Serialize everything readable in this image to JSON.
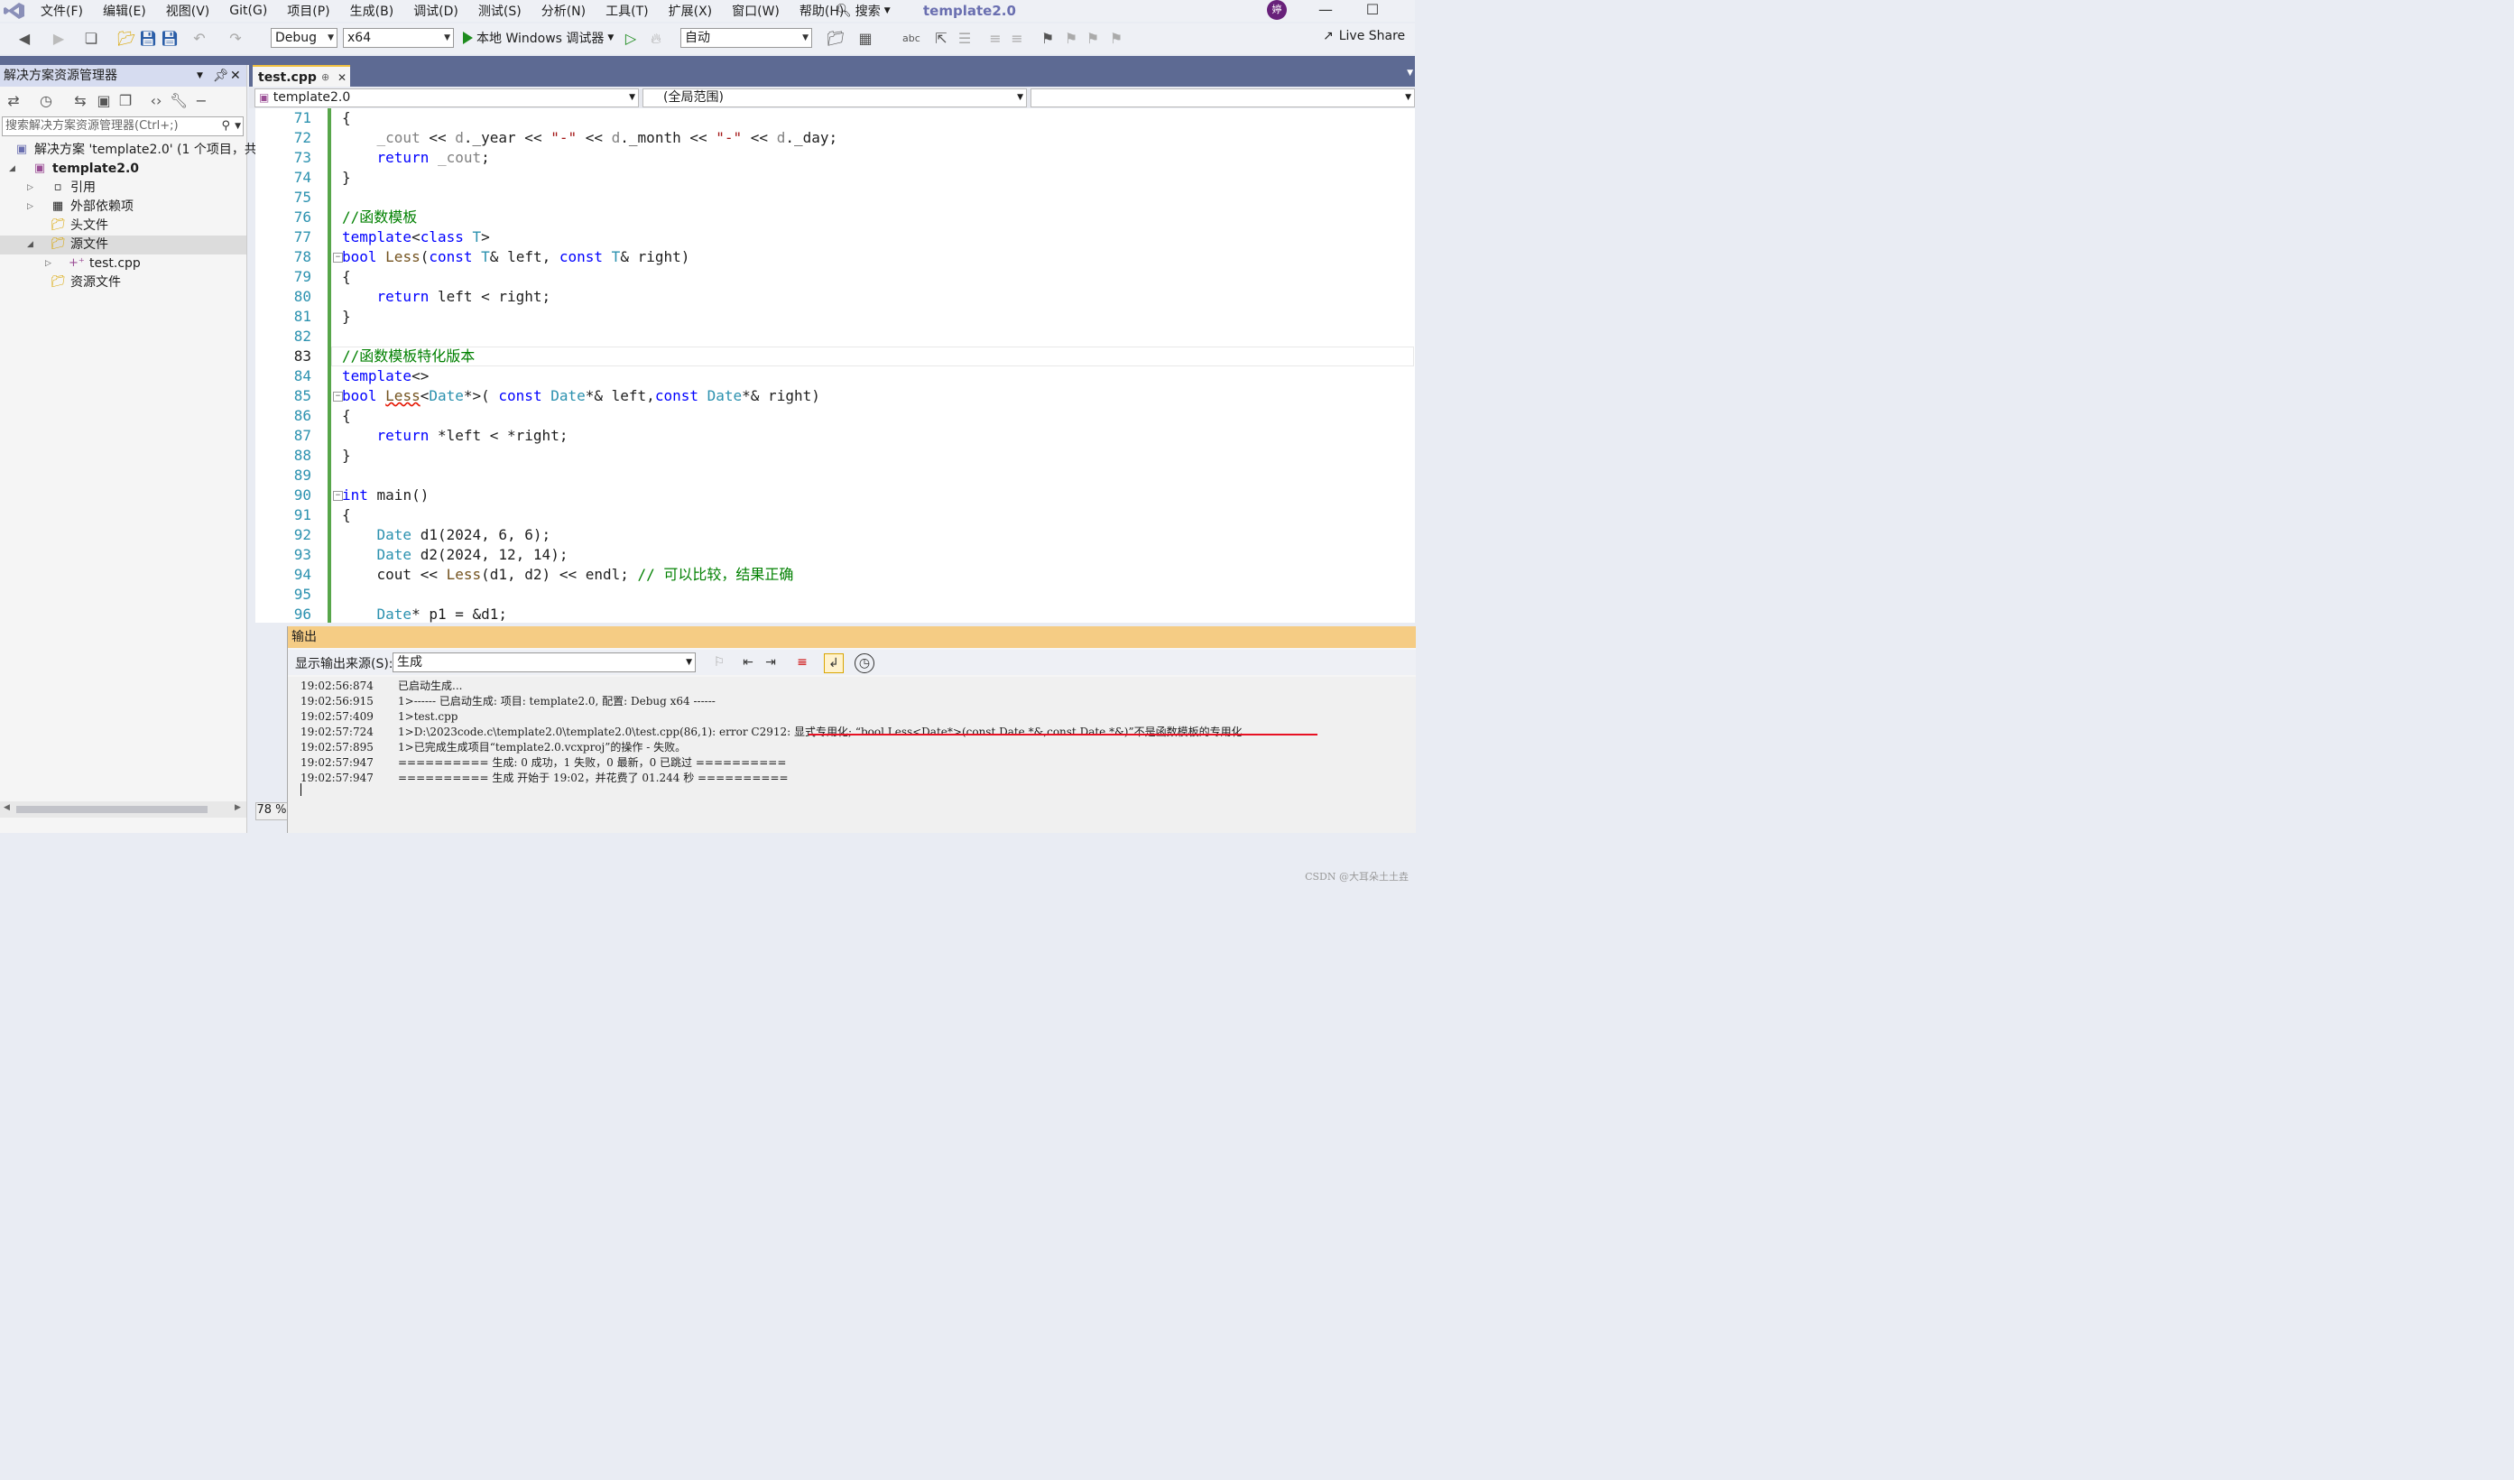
{
  "menubar": {
    "items": [
      "文件(F)",
      "编辑(E)",
      "视图(V)",
      "Git(G)",
      "项目(P)",
      "生成(B)",
      "调试(D)",
      "测试(S)",
      "分析(N)",
      "工具(T)",
      "扩展(X)",
      "窗口(W)",
      "帮助(H)"
    ],
    "search_label": "搜索",
    "window_title": "template2.0",
    "avatar_text": "婷"
  },
  "toolbar": {
    "config": "Debug",
    "platform": "x64",
    "run_label": "本地 Windows 调试器",
    "stack": "自动",
    "live_share": "Live Share"
  },
  "solution_explorer": {
    "title": "解决方案资源管理器",
    "search_placeholder": "搜索解决方案资源管理器(Ctrl+;)",
    "items": [
      {
        "label": "解决方案 'template2.0' (1 个项目，共"
      },
      {
        "label": "template2.0"
      },
      {
        "label": "引用"
      },
      {
        "label": "外部依赖项"
      },
      {
        "label": "头文件"
      },
      {
        "label": "源文件"
      },
      {
        "label": "test.cpp"
      },
      {
        "label": "资源文件"
      }
    ]
  },
  "editor": {
    "tab": "test.cpp",
    "nav_project": "template2.0",
    "nav_scope": "(全局范围)",
    "zoom": "78 %",
    "current_line": 83,
    "lines": [
      {
        "n": "71",
        "code": "{"
      },
      {
        "n": "72",
        "code": "    _cout << d._year << \"-\" << d._month << \"-\" << d._day;"
      },
      {
        "n": "73",
        "code": "    return _cout;"
      },
      {
        "n": "74",
        "code": "}"
      },
      {
        "n": "75",
        "code": ""
      },
      {
        "n": "76",
        "code": "//函数模板"
      },
      {
        "n": "77",
        "code": "template<class T>"
      },
      {
        "n": "78",
        "code": "bool Less(const T& left, const T& right)"
      },
      {
        "n": "79",
        "code": "{"
      },
      {
        "n": "80",
        "code": "    return left < right;"
      },
      {
        "n": "81",
        "code": "}"
      },
      {
        "n": "82",
        "code": ""
      },
      {
        "n": "83",
        "code": "//函数模板特化版本"
      },
      {
        "n": "84",
        "code": "template<>"
      },
      {
        "n": "85",
        "code": "bool Less<Date*>( const Date*& left,const Date*& right)"
      },
      {
        "n": "86",
        "code": "{"
      },
      {
        "n": "87",
        "code": "    return *left < *right;"
      },
      {
        "n": "88",
        "code": "}"
      },
      {
        "n": "89",
        "code": ""
      },
      {
        "n": "90",
        "code": "int main()"
      },
      {
        "n": "91",
        "code": "{"
      },
      {
        "n": "92",
        "code": "    Date d1(2024, 6, 6);"
      },
      {
        "n": "93",
        "code": "    Date d2(2024, 12, 14);"
      },
      {
        "n": "94",
        "code": "    cout << Less(d1, d2) << endl; // 可以比较，结果正确"
      },
      {
        "n": "95",
        "code": ""
      },
      {
        "n": "96",
        "code": "    Date* p1 = &d1;"
      }
    ]
  },
  "output": {
    "title": "输出",
    "source_label": "显示输出来源(S):",
    "source_value": "生成",
    "lines": [
      {
        "ts": "19:02:56:874",
        "text": "已启动生成..."
      },
      {
        "ts": "19:02:56:915",
        "text": "1>------ 已启动生成: 项目: template2.0, 配置: Debug x64 ------"
      },
      {
        "ts": "19:02:57:409",
        "text": "1>test.cpp"
      },
      {
        "ts": "19:02:57:724",
        "text": "1>D:\\2023code.c\\template2.0\\template2.0\\test.cpp(86,1): error C2912: 显式专用化; “bool Less<Date*>(const Date *&,const Date *&)”不是函数模板的专用化"
      },
      {
        "ts": "19:02:57:895",
        "text": "1>已完成生成项目“template2.0.vcxproj”的操作 - 失败。"
      },
      {
        "ts": "19:02:57:947",
        "text": "========== 生成: 0 成功，1 失败，0 最新，0 已跳过 =========="
      },
      {
        "ts": "19:02:57:947",
        "text": "========== 生成 开始于 19:02，并花费了 01.244 秒 =========="
      }
    ],
    "watermark": "CSDN @大耳朵土土垚"
  }
}
